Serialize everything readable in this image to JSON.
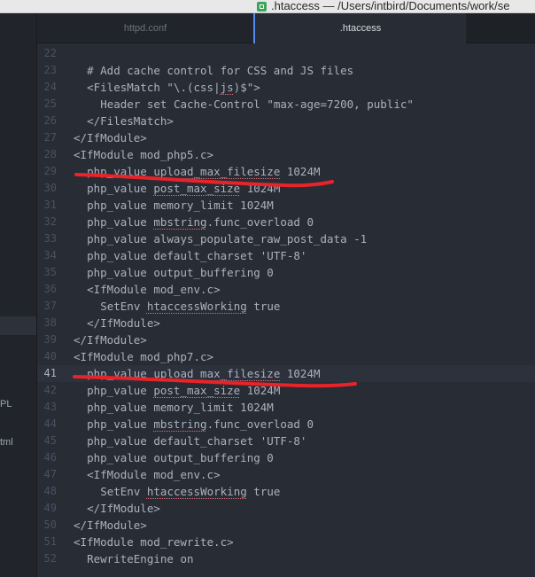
{
  "window": {
    "title": ".htaccess — /Users/intbird/Documents/work/se"
  },
  "tree": {
    "labels": [
      "PL",
      "tml"
    ]
  },
  "tabs": [
    {
      "label": "httpd.conf",
      "active": false
    },
    {
      "label": ".htaccess",
      "active": true
    }
  ],
  "editor": {
    "current_line": "41",
    "lines": [
      {
        "num": "22",
        "indent": "",
        "text": ""
      },
      {
        "num": "23",
        "indent": "  ",
        "text": "# Add cache control for CSS and JS files"
      },
      {
        "num": "24",
        "indent": "  ",
        "text": "<FilesMatch \"\\.(css|js)$\">"
      },
      {
        "num": "25",
        "indent": "    ",
        "text": "Header set Cache-Control \"max-age=7200, public\""
      },
      {
        "num": "26",
        "indent": "  ",
        "text": "</FilesMatch>"
      },
      {
        "num": "27",
        "indent": "",
        "text": "</IfModule>"
      },
      {
        "num": "28",
        "indent": "",
        "text": "<IfModule mod_php5.c>"
      },
      {
        "num": "29",
        "indent": "  ",
        "text": "php_value upload_max_filesize 1024M"
      },
      {
        "num": "30",
        "indent": "  ",
        "text": "php_value post_max_size 1024M"
      },
      {
        "num": "31",
        "indent": "  ",
        "text": "php_value memory_limit 1024M"
      },
      {
        "num": "32",
        "indent": "  ",
        "text": "php_value mbstring.func_overload 0"
      },
      {
        "num": "33",
        "indent": "  ",
        "text": "php_value always_populate_raw_post_data -1"
      },
      {
        "num": "34",
        "indent": "  ",
        "text": "php_value default_charset 'UTF-8'"
      },
      {
        "num": "35",
        "indent": "  ",
        "text": "php_value output_buffering 0"
      },
      {
        "num": "36",
        "indent": "  ",
        "text": "<IfModule mod_env.c>"
      },
      {
        "num": "37",
        "indent": "    ",
        "text": "SetEnv htaccessWorking true"
      },
      {
        "num": "38",
        "indent": "  ",
        "text": "</IfModule>"
      },
      {
        "num": "39",
        "indent": "",
        "text": "</IfModule>"
      },
      {
        "num": "40",
        "indent": "",
        "text": "<IfModule mod_php7.c>"
      },
      {
        "num": "41",
        "indent": "  ",
        "text": "php_value upload_max_filesize 1024M"
      },
      {
        "num": "42",
        "indent": "  ",
        "text": "php_value post_max_size 1024M"
      },
      {
        "num": "43",
        "indent": "  ",
        "text": "php_value memory_limit 1024M"
      },
      {
        "num": "44",
        "indent": "  ",
        "text": "php_value mbstring.func_overload 0"
      },
      {
        "num": "45",
        "indent": "  ",
        "text": "php_value default_charset 'UTF-8'"
      },
      {
        "num": "46",
        "indent": "  ",
        "text": "php_value output_buffering 0"
      },
      {
        "num": "47",
        "indent": "  ",
        "text": "<IfModule mod_env.c>"
      },
      {
        "num": "48",
        "indent": "    ",
        "text": "SetEnv htaccessWorking true"
      },
      {
        "num": "49",
        "indent": "  ",
        "text": "</IfModule>"
      },
      {
        "num": "50",
        "indent": "",
        "text": "</IfModule>"
      },
      {
        "num": "51",
        "indent": "",
        "text": "<IfModule mod_rewrite.c>"
      },
      {
        "num": "52",
        "indent": "  ",
        "text": "RewriteEngine on"
      }
    ]
  },
  "colors": {
    "annotation": "#e8232a",
    "accent": "#568af2",
    "squiggle": "#e06c75"
  }
}
